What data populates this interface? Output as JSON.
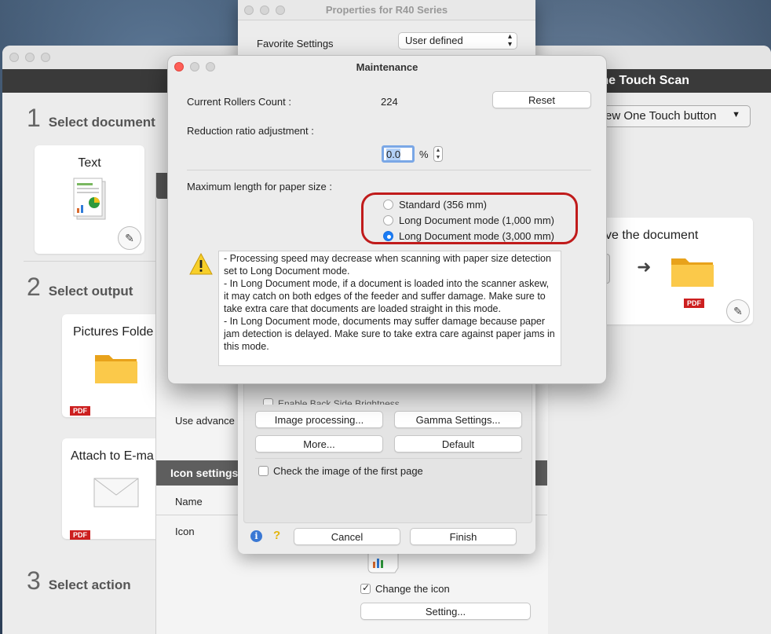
{
  "properties_window": {
    "title": "Properties for R40 Series",
    "favorite_label": "Favorite Settings",
    "favorite_value": "User defined",
    "enable_back_brightness": "Enable Back Side Brightness",
    "image_processing_btn": "Image processing...",
    "gamma_btn": "Gamma Settings...",
    "more_btn": "More...",
    "default_btn": "Default",
    "check_first_page": "Check the image of the first page",
    "cancel_btn": "Cancel",
    "finish_btn": "Finish"
  },
  "main_window": {
    "title": "ne Touch Scan",
    "view_button": "ew One Touch button",
    "step1": {
      "num": "1",
      "label": "Select document"
    },
    "step2": {
      "num": "2",
      "label": "Select output"
    },
    "step3": {
      "num": "3",
      "label": "Select action"
    },
    "doc_card": "Text",
    "output_cards": [
      {
        "title": "Pictures Folde",
        "badge": "PDF"
      },
      {
        "title": "Attach to E-ma",
        "badge": "PDF"
      }
    ],
    "save_card": {
      "title": "ve the document",
      "badge": "PDF"
    }
  },
  "behind_panel": {
    "use_advanced": "Use advance",
    "icon_settings": "Icon settings",
    "name_label": "Name",
    "icon_label": "Icon",
    "change_icon": "Change the icon",
    "setting_btn": "Setting..."
  },
  "maintenance": {
    "title": "Maintenance",
    "rollers_label": "Current Rollers Count :",
    "rollers_value": "224",
    "reset_btn": "Reset",
    "ratio_label": "Reduction ratio adjustment :",
    "ratio_value": "0.0",
    "ratio_unit": "%",
    "max_length_label": "Maximum length for paper size :",
    "options": [
      {
        "label": "Standard (356 mm)",
        "selected": false
      },
      {
        "label": "Long Document mode (1,000 mm)",
        "selected": false
      },
      {
        "label": "Long Document mode (3,000 mm)",
        "selected": true
      }
    ],
    "warning_text": "- Processing speed may decrease when scanning with paper size detection set to Long Document mode.\n- In Long Document mode, if a document is loaded into the scanner askew, it may catch on both edges of the feeder and suffer damage. Make sure to take extra care that documents are loaded straight in this mode.\n- In Long Document mode, documents may suffer damage because paper jam detection is delayed. Make sure to take extra care against paper jams in this mode."
  },
  "colors": {
    "accent": "#1a7cf5",
    "highlight": "#c01b1b",
    "pdf_badge": "#cc1f1f"
  }
}
